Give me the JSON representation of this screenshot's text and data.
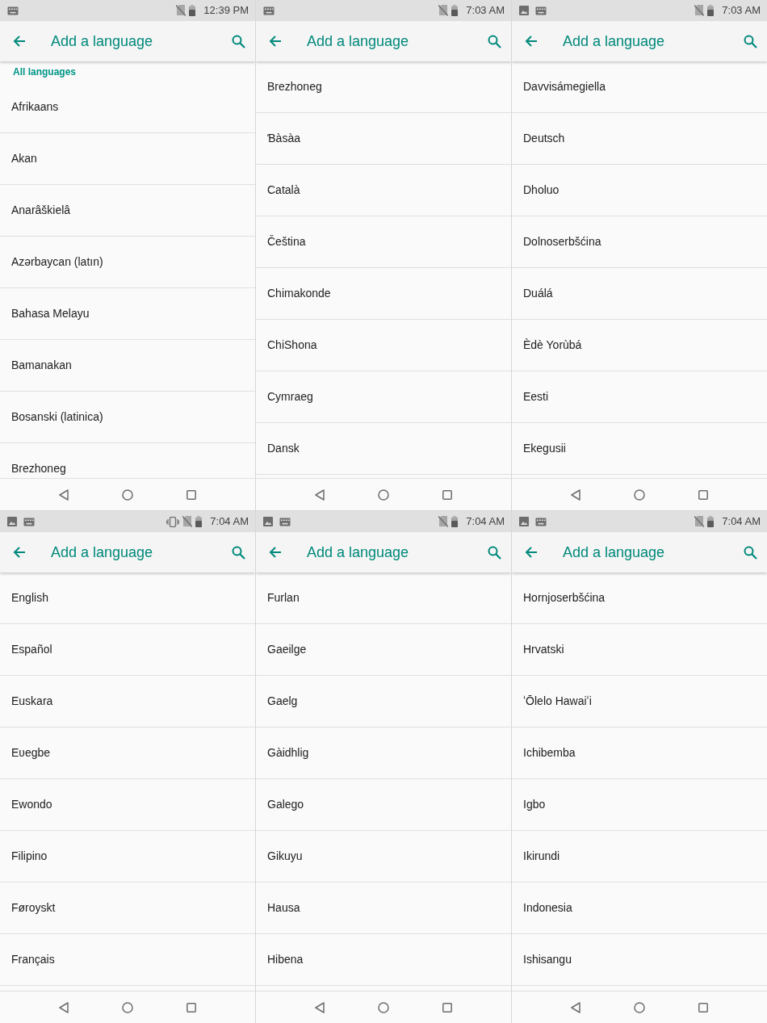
{
  "screens": [
    {
      "status_bar": {
        "notification_icons": [
          {
            "kind": "keyboard"
          }
        ],
        "system_icons": [
          {
            "kind": "no_sim"
          },
          {
            "kind": "battery"
          }
        ],
        "time": "12:39 PM"
      },
      "app_bar": {
        "title": "Add a language"
      },
      "section_header": "All languages",
      "languages": [
        "Afrikaans",
        "Akan",
        "Anarâškielâ",
        "Azərbaycan (latın)",
        "Bahasa Melayu",
        "Bamanakan",
        "Bosanski (latinica)",
        "Brezhoneg"
      ]
    },
    {
      "status_bar": {
        "notification_icons": [
          {
            "kind": "keyboard"
          }
        ],
        "system_icons": [
          {
            "kind": "no_sim"
          },
          {
            "kind": "battery"
          }
        ],
        "time": "7:03 AM"
      },
      "app_bar": {
        "title": "Add a language"
      },
      "languages": [
        "Brezhoneg",
        "Ɓàsàa",
        "Català",
        "Čeština",
        "Chimakonde",
        "ChiShona",
        "Cymraeg",
        "Dansk"
      ]
    },
    {
      "status_bar": {
        "notification_icons": [
          {
            "kind": "image"
          },
          {
            "kind": "keyboard"
          }
        ],
        "system_icons": [
          {
            "kind": "no_sim"
          },
          {
            "kind": "battery"
          }
        ],
        "time": "7:03 AM"
      },
      "app_bar": {
        "title": "Add a language"
      },
      "languages": [
        "Davvisámegiella",
        "Deutsch",
        "Dholuo",
        "Dolnoserbšćina",
        "Duálá",
        "Èdè Yorùbá",
        "Eesti",
        "Ekegusii"
      ]
    },
    {
      "status_bar": {
        "notification_icons": [
          {
            "kind": "image"
          },
          {
            "kind": "keyboard"
          }
        ],
        "system_icons": [
          {
            "kind": "vibrate"
          },
          {
            "kind": "no_sim"
          },
          {
            "kind": "battery"
          }
        ],
        "time": "7:04 AM"
      },
      "app_bar": {
        "title": "Add a language"
      },
      "languages": [
        "English",
        "Español",
        "Euskara",
        "Eʋegbe",
        "Ewondo",
        "Filipino",
        "Føroyskt",
        "Français"
      ]
    },
    {
      "status_bar": {
        "notification_icons": [
          {
            "kind": "image"
          },
          {
            "kind": "keyboard"
          }
        ],
        "system_icons": [
          {
            "kind": "no_sim"
          },
          {
            "kind": "battery"
          }
        ],
        "time": "7:04 AM"
      },
      "app_bar": {
        "title": "Add a language"
      },
      "languages": [
        "Furlan",
        "Gaeilge",
        "Gaelg",
        "Gàidhlig",
        "Galego",
        "Gikuyu",
        "Hausa",
        "Hibena"
      ]
    },
    {
      "status_bar": {
        "notification_icons": [
          {
            "kind": "image"
          },
          {
            "kind": "keyboard"
          }
        ],
        "system_icons": [
          {
            "kind": "no_sim"
          },
          {
            "kind": "battery"
          }
        ],
        "time": "7:04 AM"
      },
      "app_bar": {
        "title": "Add a language"
      },
      "languages": [
        "Hornjoserbšćina",
        "Hrvatski",
        "ʻŌlelo Hawaiʻi",
        "Ichibemba",
        "Igbo",
        "Ikirundi",
        "Indonesia",
        "Ishisangu"
      ]
    }
  ]
}
